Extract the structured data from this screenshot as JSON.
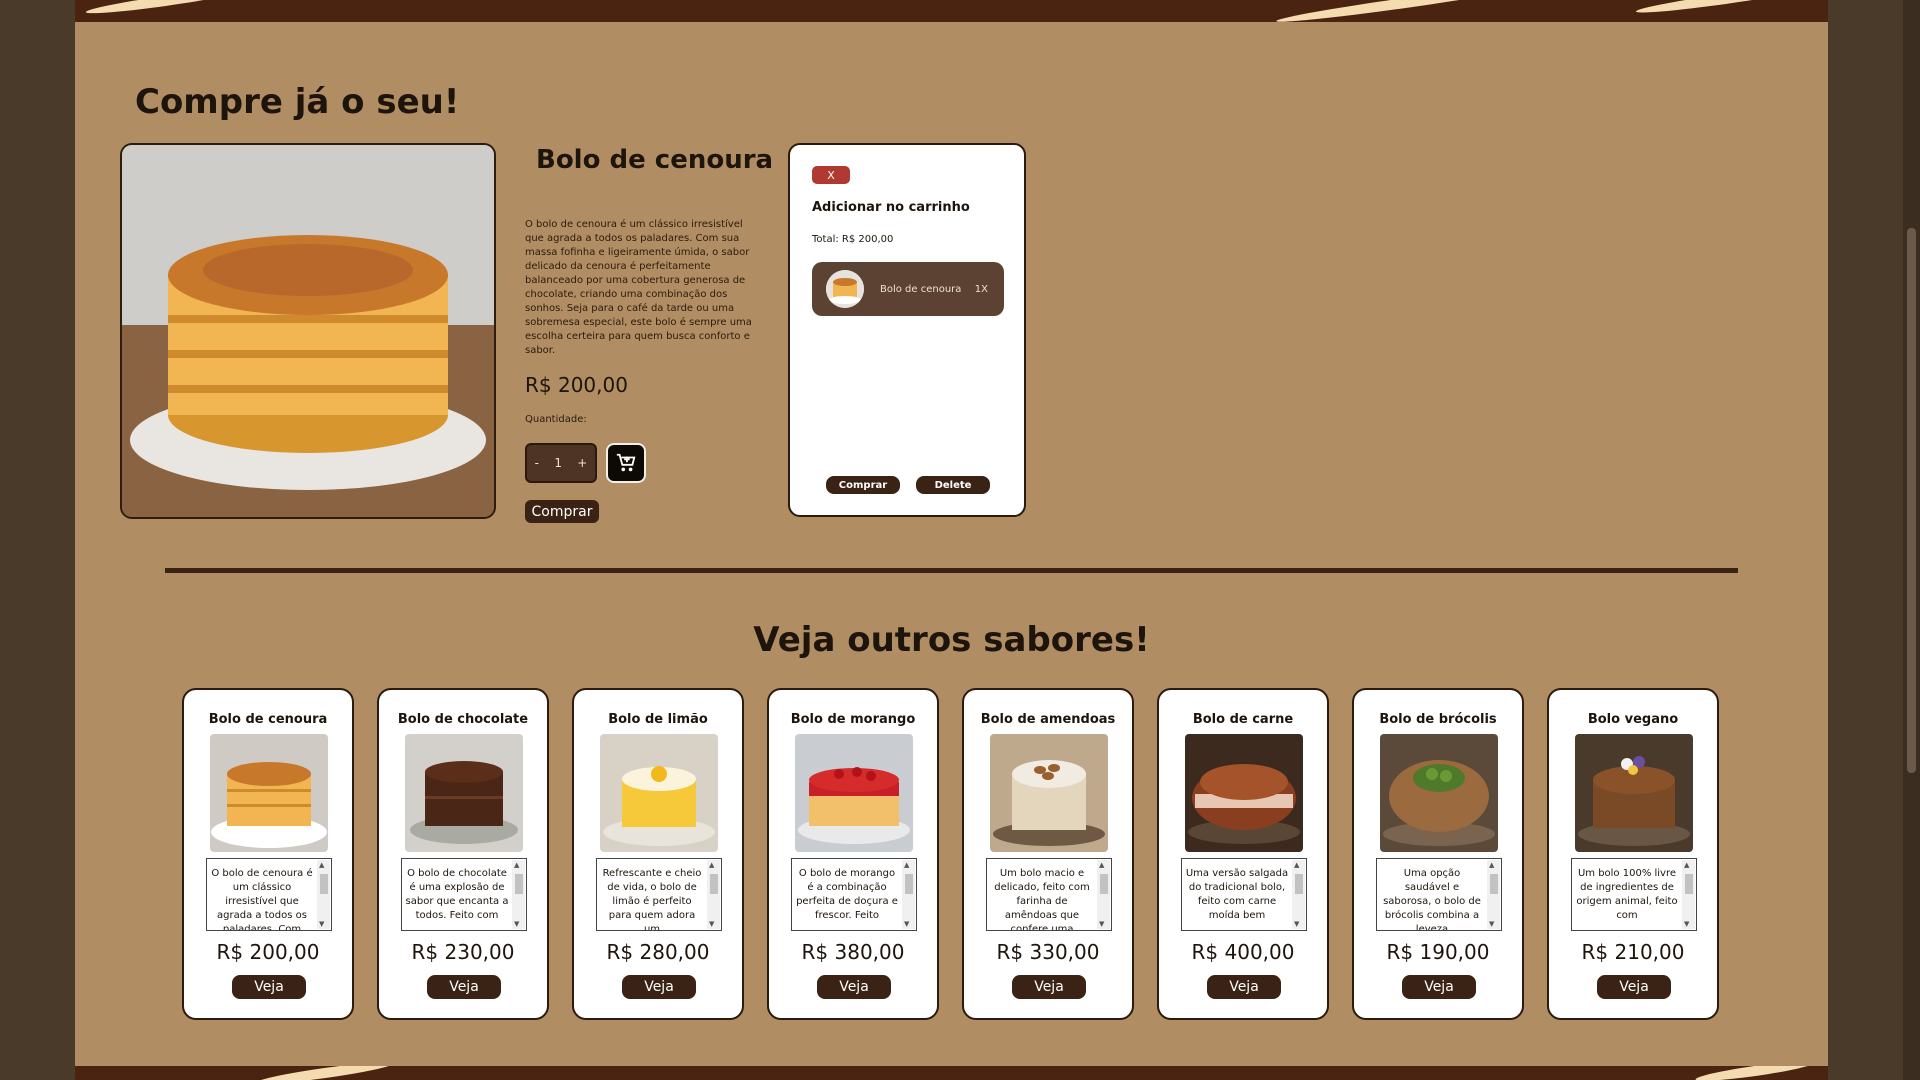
{
  "header": {
    "title": "Compre já o seu!"
  },
  "product": {
    "name": "Bolo de cenoura",
    "description": "O bolo de cenoura é um clássico irresistível que agrada a todos os paladares. Com sua massa fofinha e ligeiramente úmida, o sabor delicado da cenoura é perfeitamente balanceado por uma cobertura generosa de chocolate, criando uma combinação dos sonhos. Seja para o café da tarde ou uma sobremesa especial, este bolo é sempre uma escolha certeira para quem busca conforto e sabor.",
    "price": "R$ 200,00",
    "quantity_label": "Quantidade:",
    "minus": "-",
    "quantity": "1",
    "plus": "+",
    "buy_label": "Comprar"
  },
  "cart": {
    "close_label": "X",
    "title": "Adicionar no carrinho",
    "total": "Total: R$ 200,00",
    "items": [
      {
        "name": "Bolo de cenoura",
        "qty": "1X"
      }
    ],
    "buy_label": "Comprar",
    "delete_label": "Delete"
  },
  "others": {
    "title": "Veja outros sabores!",
    "button_label": "Veja",
    "cards": [
      {
        "name": "Bolo de cenoura",
        "desc": "O bolo de cenoura é um clássico irresistível que agrada a todos os paladares. Com",
        "price": "R$ 200,00"
      },
      {
        "name": "Bolo de chocolate",
        "desc": "O bolo de chocolate é uma explosão de sabor que encanta a todos. Feito com",
        "price": "R$ 230,00"
      },
      {
        "name": "Bolo de limão",
        "desc": "Refrescante e cheio de vida, o bolo de limão é perfeito para quem adora um",
        "price": "R$ 280,00"
      },
      {
        "name": "Bolo de morango",
        "desc": "O bolo de morango é a combinação perfeita de doçura e frescor. Feito",
        "price": "R$ 380,00"
      },
      {
        "name": "Bolo de amendoas",
        "desc": "Um bolo macio e delicado, feito com farinha de amêndoas que confere uma",
        "price": "R$ 330,00"
      },
      {
        "name": "Bolo de carne",
        "desc": "Uma versão salgada do tradicional bolo, feito com carne moída bem",
        "price": "R$ 400,00"
      },
      {
        "name": "Bolo de brócolis",
        "desc": "Uma opção saudável e saborosa, o bolo de brócolis combina a leveza",
        "price": "R$ 190,00"
      },
      {
        "name": "Bolo vegano",
        "desc": "Um bolo 100% livre de ingredientes de origem animal, feito com",
        "price": "R$ 210,00"
      }
    ]
  }
}
